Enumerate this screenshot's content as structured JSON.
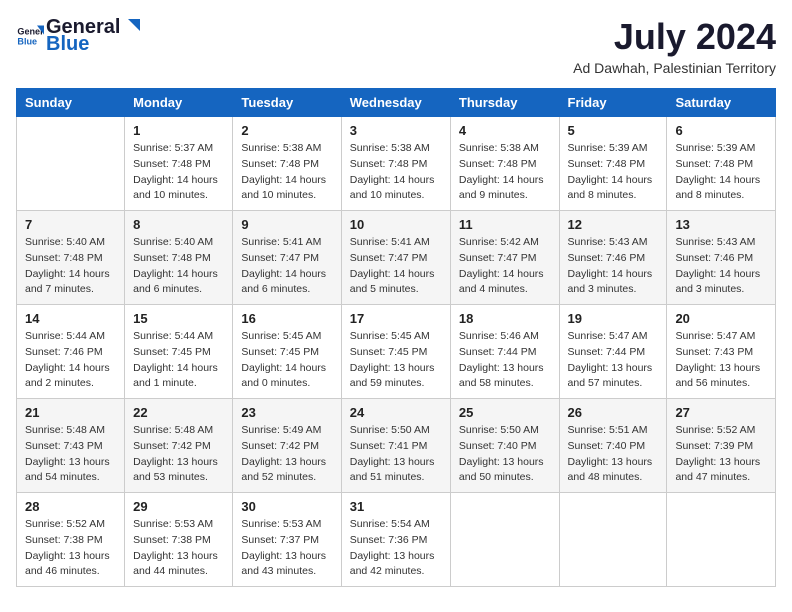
{
  "header": {
    "logo_general": "General",
    "logo_blue": "Blue",
    "month_title": "July 2024",
    "subtitle": "Ad Dawhah, Palestinian Territory"
  },
  "days_of_week": [
    "Sunday",
    "Monday",
    "Tuesday",
    "Wednesday",
    "Thursday",
    "Friday",
    "Saturday"
  ],
  "weeks": [
    [
      null,
      {
        "num": "1",
        "sunrise": "Sunrise: 5:37 AM",
        "sunset": "Sunset: 7:48 PM",
        "daylight": "Daylight: 14 hours and 10 minutes."
      },
      {
        "num": "2",
        "sunrise": "Sunrise: 5:38 AM",
        "sunset": "Sunset: 7:48 PM",
        "daylight": "Daylight: 14 hours and 10 minutes."
      },
      {
        "num": "3",
        "sunrise": "Sunrise: 5:38 AM",
        "sunset": "Sunset: 7:48 PM",
        "daylight": "Daylight: 14 hours and 10 minutes."
      },
      {
        "num": "4",
        "sunrise": "Sunrise: 5:38 AM",
        "sunset": "Sunset: 7:48 PM",
        "daylight": "Daylight: 14 hours and 9 minutes."
      },
      {
        "num": "5",
        "sunrise": "Sunrise: 5:39 AM",
        "sunset": "Sunset: 7:48 PM",
        "daylight": "Daylight: 14 hours and 8 minutes."
      },
      {
        "num": "6",
        "sunrise": "Sunrise: 5:39 AM",
        "sunset": "Sunset: 7:48 PM",
        "daylight": "Daylight: 14 hours and 8 minutes."
      }
    ],
    [
      {
        "num": "7",
        "sunrise": "Sunrise: 5:40 AM",
        "sunset": "Sunset: 7:48 PM",
        "daylight": "Daylight: 14 hours and 7 minutes."
      },
      {
        "num": "8",
        "sunrise": "Sunrise: 5:40 AM",
        "sunset": "Sunset: 7:48 PM",
        "daylight": "Daylight: 14 hours and 6 minutes."
      },
      {
        "num": "9",
        "sunrise": "Sunrise: 5:41 AM",
        "sunset": "Sunset: 7:47 PM",
        "daylight": "Daylight: 14 hours and 6 minutes."
      },
      {
        "num": "10",
        "sunrise": "Sunrise: 5:41 AM",
        "sunset": "Sunset: 7:47 PM",
        "daylight": "Daylight: 14 hours and 5 minutes."
      },
      {
        "num": "11",
        "sunrise": "Sunrise: 5:42 AM",
        "sunset": "Sunset: 7:47 PM",
        "daylight": "Daylight: 14 hours and 4 minutes."
      },
      {
        "num": "12",
        "sunrise": "Sunrise: 5:43 AM",
        "sunset": "Sunset: 7:46 PM",
        "daylight": "Daylight: 14 hours and 3 minutes."
      },
      {
        "num": "13",
        "sunrise": "Sunrise: 5:43 AM",
        "sunset": "Sunset: 7:46 PM",
        "daylight": "Daylight: 14 hours and 3 minutes."
      }
    ],
    [
      {
        "num": "14",
        "sunrise": "Sunrise: 5:44 AM",
        "sunset": "Sunset: 7:46 PM",
        "daylight": "Daylight: 14 hours and 2 minutes."
      },
      {
        "num": "15",
        "sunrise": "Sunrise: 5:44 AM",
        "sunset": "Sunset: 7:45 PM",
        "daylight": "Daylight: 14 hours and 1 minute."
      },
      {
        "num": "16",
        "sunrise": "Sunrise: 5:45 AM",
        "sunset": "Sunset: 7:45 PM",
        "daylight": "Daylight: 14 hours and 0 minutes."
      },
      {
        "num": "17",
        "sunrise": "Sunrise: 5:45 AM",
        "sunset": "Sunset: 7:45 PM",
        "daylight": "Daylight: 13 hours and 59 minutes."
      },
      {
        "num": "18",
        "sunrise": "Sunrise: 5:46 AM",
        "sunset": "Sunset: 7:44 PM",
        "daylight": "Daylight: 13 hours and 58 minutes."
      },
      {
        "num": "19",
        "sunrise": "Sunrise: 5:47 AM",
        "sunset": "Sunset: 7:44 PM",
        "daylight": "Daylight: 13 hours and 57 minutes."
      },
      {
        "num": "20",
        "sunrise": "Sunrise: 5:47 AM",
        "sunset": "Sunset: 7:43 PM",
        "daylight": "Daylight: 13 hours and 56 minutes."
      }
    ],
    [
      {
        "num": "21",
        "sunrise": "Sunrise: 5:48 AM",
        "sunset": "Sunset: 7:43 PM",
        "daylight": "Daylight: 13 hours and 54 minutes."
      },
      {
        "num": "22",
        "sunrise": "Sunrise: 5:48 AM",
        "sunset": "Sunset: 7:42 PM",
        "daylight": "Daylight: 13 hours and 53 minutes."
      },
      {
        "num": "23",
        "sunrise": "Sunrise: 5:49 AM",
        "sunset": "Sunset: 7:42 PM",
        "daylight": "Daylight: 13 hours and 52 minutes."
      },
      {
        "num": "24",
        "sunrise": "Sunrise: 5:50 AM",
        "sunset": "Sunset: 7:41 PM",
        "daylight": "Daylight: 13 hours and 51 minutes."
      },
      {
        "num": "25",
        "sunrise": "Sunrise: 5:50 AM",
        "sunset": "Sunset: 7:40 PM",
        "daylight": "Daylight: 13 hours and 50 minutes."
      },
      {
        "num": "26",
        "sunrise": "Sunrise: 5:51 AM",
        "sunset": "Sunset: 7:40 PM",
        "daylight": "Daylight: 13 hours and 48 minutes."
      },
      {
        "num": "27",
        "sunrise": "Sunrise: 5:52 AM",
        "sunset": "Sunset: 7:39 PM",
        "daylight": "Daylight: 13 hours and 47 minutes."
      }
    ],
    [
      {
        "num": "28",
        "sunrise": "Sunrise: 5:52 AM",
        "sunset": "Sunset: 7:38 PM",
        "daylight": "Daylight: 13 hours and 46 minutes."
      },
      {
        "num": "29",
        "sunrise": "Sunrise: 5:53 AM",
        "sunset": "Sunset: 7:38 PM",
        "daylight": "Daylight: 13 hours and 44 minutes."
      },
      {
        "num": "30",
        "sunrise": "Sunrise: 5:53 AM",
        "sunset": "Sunset: 7:37 PM",
        "daylight": "Daylight: 13 hours and 43 minutes."
      },
      {
        "num": "31",
        "sunrise": "Sunrise: 5:54 AM",
        "sunset": "Sunset: 7:36 PM",
        "daylight": "Daylight: 13 hours and 42 minutes."
      },
      null,
      null,
      null
    ]
  ]
}
